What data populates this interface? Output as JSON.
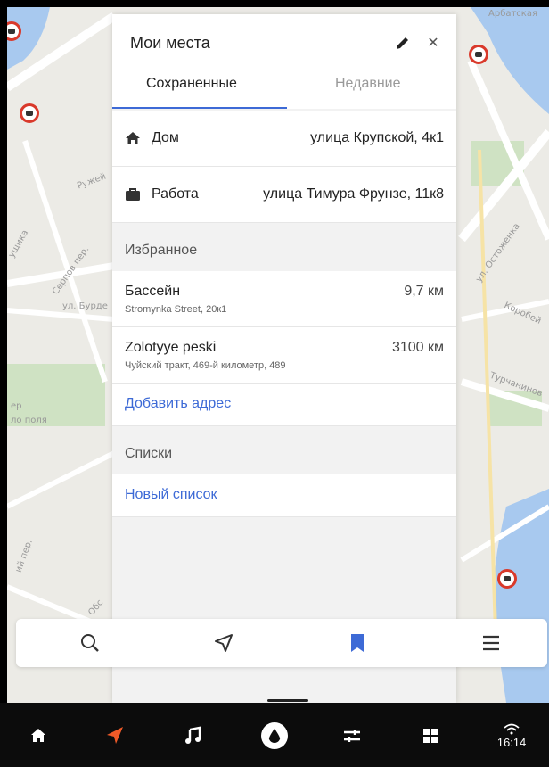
{
  "panel": {
    "title": "Мои места",
    "tabs": [
      {
        "label": "Сохраненные",
        "active": true
      },
      {
        "label": "Недавние",
        "active": false
      }
    ],
    "home": {
      "label": "Дом",
      "address": "улица Крупской, 4к1"
    },
    "work": {
      "label": "Работа",
      "address": "улица Тимура Фрунзе, 11к8"
    },
    "favorites_header": "Избранное",
    "favorites": [
      {
        "name": "Бассейн",
        "address": "Stromynka Street, 20к1",
        "distance": "9,7 км"
      },
      {
        "name": "Zolotyye peski",
        "address": "Чуйский тракт, 469-й километр, 489",
        "distance": "3100 км"
      }
    ],
    "add_address": "Добавить адрес",
    "lists_header": "Списки",
    "new_list": "Новый список"
  },
  "map_labels": {
    "l1": "Арбатская",
    "l2": "Ружей",
    "l3": "ущика",
    "l4": "Серпов пер.",
    "l5": "ул. Бурде",
    "l6": "ул. Остоженка",
    "l7": "Коробей",
    "l8": "Турчанинов",
    "l9": "ер",
    "l10": "ло поля",
    "l11": "ий пер.",
    "l12": "Обс"
  },
  "bottom_bar": {
    "icons": [
      "search-icon",
      "navigation-arrow-icon",
      "bookmarks-icon",
      "menu-icon"
    ],
    "active": "bookmarks-icon"
  },
  "system_bar": {
    "time": "16:14",
    "icons": [
      "home-icon",
      "navigator-icon",
      "music-icon",
      "alice-icon",
      "settings-sliders-icon",
      "apps-grid-icon"
    ]
  },
  "colors": {
    "accent": "#3d6ad6",
    "nav_active": "#f05a28",
    "camera_red": "#d9392b",
    "system_bar": "#0c0c0c"
  }
}
